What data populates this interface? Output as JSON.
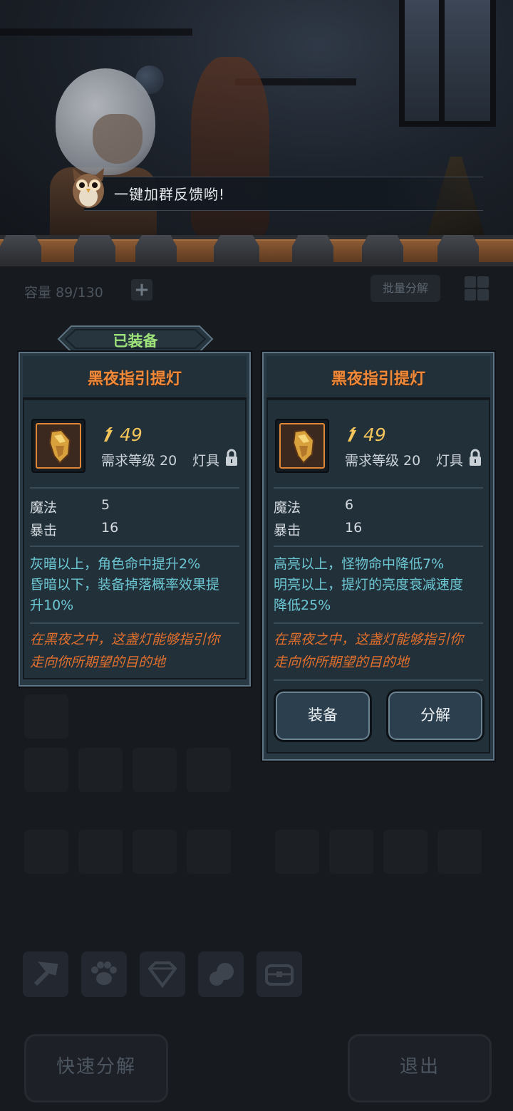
{
  "speech": {
    "text": "一键加群反馈哟!"
  },
  "inventory": {
    "capacity_text": "容量 89/130",
    "add_button": "+",
    "batch_decompose": "批量分解"
  },
  "equipped_tab": {
    "label": "已装备"
  },
  "cards": [
    {
      "title": "黑夜指引提灯",
      "power": "49",
      "required_level": "需求等级 20",
      "slot_type": "灯具",
      "stats": [
        {
          "name": "魔法",
          "value": "5"
        },
        {
          "name": "暴击",
          "value": "16"
        }
      ],
      "effects": [
        "灰暗以上，角色命中提升2%",
        "昏暗以下，装备掉落概率效果提",
        "升10%"
      ],
      "flavor": [
        "在黑夜之中，这盏灯能够指引你",
        "走向你所期望的目的地"
      ]
    },
    {
      "title": "黑夜指引提灯",
      "power": "49",
      "required_level": "需求等级 20",
      "slot_type": "灯具",
      "stats": [
        {
          "name": "魔法",
          "value": "6"
        },
        {
          "name": "暴击",
          "value": "16"
        }
      ],
      "effects": [
        "高亮以上，怪物命中降低7%",
        "明亮以上，提灯的亮度衰减速度",
        "降低25%"
      ],
      "flavor": [
        "在黑夜之中，这盏灯能够指引你",
        "走向你所期望的目的地"
      ],
      "buttons": {
        "equip": "装备",
        "decompose": "分解"
      }
    }
  ],
  "category_tabs": [
    "hammer-icon",
    "paw-icon",
    "gem-icon",
    "ore-icon",
    "chest-icon"
  ],
  "bottom": {
    "quick_decompose": "快速分解",
    "exit": "退出"
  },
  "colors": {
    "item_title": "#f08a3a",
    "power": "#f3c55a",
    "effect": "#6cc8d4",
    "flavor": "#e2702d",
    "equipped": "#9ee37a"
  }
}
